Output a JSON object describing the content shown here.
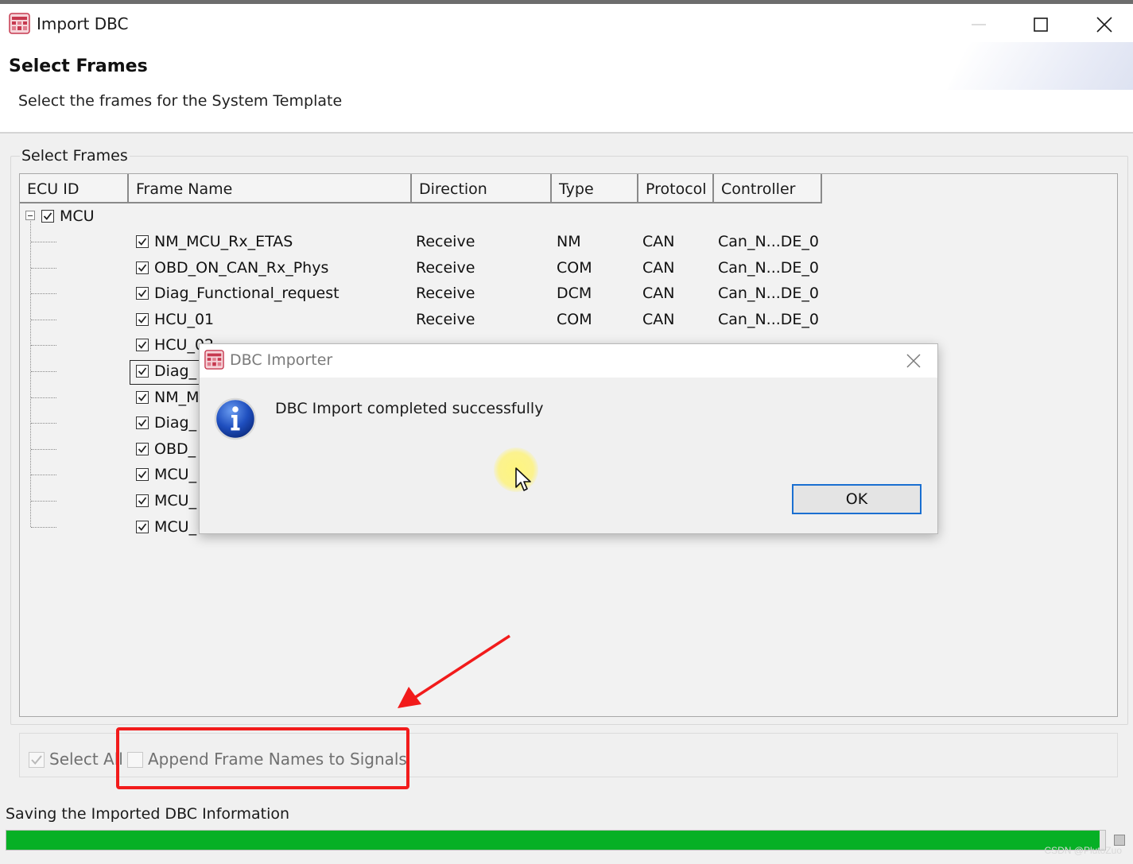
{
  "window": {
    "title": "Import DBC",
    "icon": "dbc-app-icon"
  },
  "header": {
    "title": "Select Frames",
    "subtitle": "Select the frames for the System Template"
  },
  "group": {
    "label": "Select Frames"
  },
  "table": {
    "columns": [
      "ECU ID",
      "Frame Name",
      "Direction",
      "Type",
      "Protocol",
      "Controller"
    ],
    "ecu": {
      "name": "MCU",
      "checked": true,
      "expanded": true
    },
    "rows": [
      {
        "frame": "NM_MCU_Rx_ETAS",
        "direction": "Receive",
        "type": "NM",
        "protocol": "CAN",
        "controller": "Can_N...DE_0"
      },
      {
        "frame": "OBD_ON_CAN_Rx_Phys",
        "direction": "Receive",
        "type": "COM",
        "protocol": "CAN",
        "controller": "Can_N...DE_0"
      },
      {
        "frame": "Diag_Functional_request",
        "direction": "Receive",
        "type": "DCM",
        "protocol": "CAN",
        "controller": "Can_N...DE_0"
      },
      {
        "frame": "HCU_01",
        "direction": "Receive",
        "type": "COM",
        "protocol": "CAN",
        "controller": "Can_N...DE_0"
      },
      {
        "frame": "HCU_02",
        "direction": "",
        "type": "",
        "protocol": "",
        "controller": ""
      },
      {
        "frame": "Diag_",
        "direction": "",
        "type": "",
        "protocol": "",
        "controller": ""
      },
      {
        "frame": "NM_M",
        "direction": "",
        "type": "",
        "protocol": "",
        "controller": ""
      },
      {
        "frame": "Diag_",
        "direction": "",
        "type": "",
        "protocol": "",
        "controller": ""
      },
      {
        "frame": "OBD_",
        "direction": "",
        "type": "",
        "protocol": "",
        "controller": ""
      },
      {
        "frame": "MCU_",
        "direction": "",
        "type": "",
        "protocol": "",
        "controller": ""
      },
      {
        "frame": "MCU_",
        "direction": "",
        "type": "",
        "protocol": "",
        "controller": ""
      },
      {
        "frame": "MCU_",
        "direction": "",
        "type": "",
        "protocol": "",
        "controller": ""
      }
    ]
  },
  "options": {
    "select_all": {
      "label": "Select All",
      "checked": true,
      "enabled": false
    },
    "append_names": {
      "label": "Append Frame Names to Signals",
      "checked": false,
      "enabled": false
    }
  },
  "status": {
    "text": "Saving the Imported DBC Information",
    "progress": 0.995,
    "progress_color": "#06b025"
  },
  "watermark": "CSDN @PlutoZuo",
  "dialog": {
    "title": "DBC Importer",
    "message": "DBC Import completed successfully",
    "ok_label": "OK",
    "icon": "info-icon"
  },
  "colors": {
    "accent": "#1a6fd1",
    "annotation": "#f21b1b"
  }
}
